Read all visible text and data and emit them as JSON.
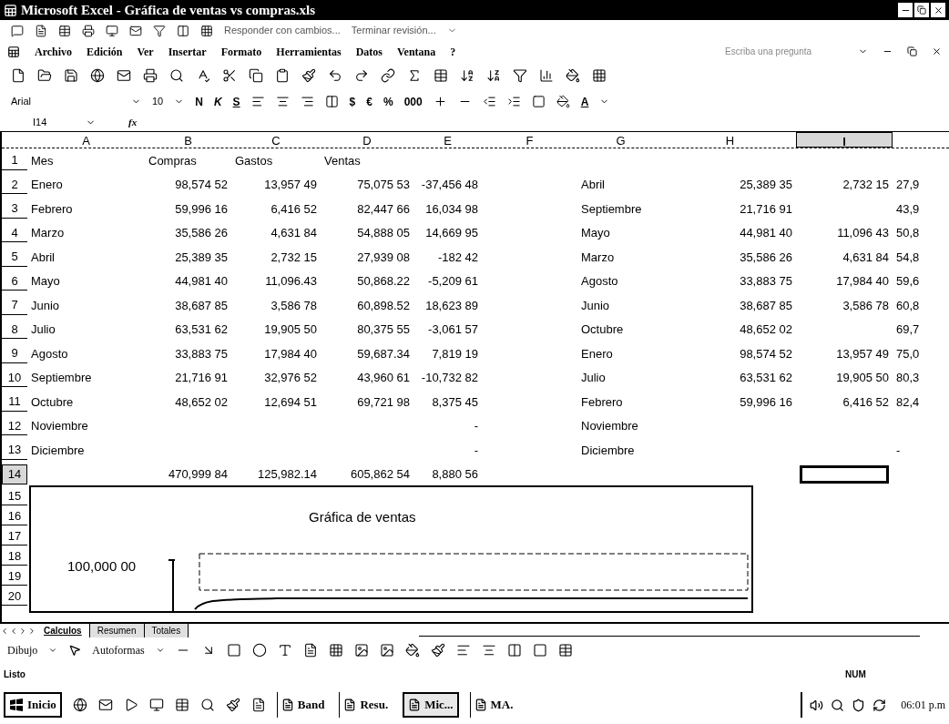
{
  "window": {
    "title": "Microsoft Excel - Gráfica de ventas vs compras.xls"
  },
  "review_toolbar": {
    "reply": "Responder con cambios...",
    "end": "Terminar revisión..."
  },
  "menu": [
    {
      "label": "Archivo"
    },
    {
      "label": "Edición"
    },
    {
      "label": "Ver"
    },
    {
      "label": "Insertar"
    },
    {
      "label": "Formato"
    },
    {
      "label": "Herramientas"
    },
    {
      "label": "Datos"
    },
    {
      "label": "Ventana"
    },
    {
      "label": "?"
    }
  ],
  "help_box": {
    "placeholder": "Escriba una pregunta"
  },
  "format_toolbar": {
    "font": "Arial",
    "size": "10",
    "bold": "N",
    "italic": "K",
    "underline": "S",
    "number_buttons": [
      "$",
      "€",
      "%",
      "000"
    ],
    "font_color": "A"
  },
  "formula_bar": {
    "name_box": "I14",
    "fx": "fx"
  },
  "sheet": {
    "columns": [
      {
        "label": "A",
        "selected": false
      },
      {
        "label": "B",
        "selected": false
      },
      {
        "label": "C",
        "selected": false
      },
      {
        "label": "D",
        "selected": false
      },
      {
        "label": "E",
        "selected": false
      },
      {
        "label": "F",
        "selected": false
      },
      {
        "label": "G",
        "selected": false
      },
      {
        "label": "H",
        "selected": false
      },
      {
        "label": "I",
        "selected": true
      }
    ],
    "rows": [
      {
        "number": "1",
        "kind": "header",
        "selected": false,
        "cells": [
          {
            "text": "Mes"
          },
          {
            "text": "Compras"
          },
          {
            "text": "Gastos"
          },
          {
            "text": "Ventas"
          },
          {},
          {},
          {},
          {},
          {},
          {}
        ]
      },
      {
        "number": "2",
        "kind": "data",
        "selected": false,
        "cells": [
          {
            "text": "Enero"
          },
          {
            "text": "98,574 52"
          },
          {
            "text": "13,957 49"
          },
          {
            "text": "75,075 53"
          },
          {
            "sign": "-",
            "text": "37,456 48"
          },
          {},
          {
            "text": "Abril"
          },
          {
            "text": "25,389 35"
          },
          {
            "text": "2,732 15"
          },
          {
            "text": "27,9"
          }
        ]
      },
      {
        "number": "3",
        "kind": "data",
        "selected": false,
        "cells": [
          {
            "text": "Febrero"
          },
          {
            "text": "59,996 16"
          },
          {
            "text": "6,416 52"
          },
          {
            "text": "82,447 66"
          },
          {
            "text": "16,034 98"
          },
          {},
          {
            "text": "Septiembre"
          },
          {
            "text": "21,716 91"
          },
          {},
          {
            "text": "43,9"
          }
        ]
      },
      {
        "number": "4",
        "kind": "data",
        "selected": false,
        "cells": [
          {
            "text": "Marzo"
          },
          {
            "text": "35,586 26"
          },
          {
            "text": "4,631 84"
          },
          {
            "text": "54,888 05"
          },
          {
            "text": "14,669 95"
          },
          {},
          {
            "text": "Mayo"
          },
          {
            "text": "44,981 40"
          },
          {
            "text": "11,096 43"
          },
          {
            "text": "50,8"
          }
        ]
      },
      {
        "number": "5",
        "kind": "data",
        "selected": false,
        "cells": [
          {
            "text": "Abril"
          },
          {
            "text": "25,389 35"
          },
          {
            "text": "2,732 15"
          },
          {
            "text": "27,939 08"
          },
          {
            "sign": "-",
            "text": "182 42"
          },
          {},
          {
            "text": "Marzo"
          },
          {
            "text": "35,586 26"
          },
          {
            "text": "4,631 84"
          },
          {
            "text": "54,8"
          }
        ]
      },
      {
        "number": "6",
        "kind": "data",
        "selected": false,
        "cells": [
          {
            "text": "Mayo"
          },
          {
            "text": "44,981 40"
          },
          {
            "text": "11,096.43"
          },
          {
            "text": "50,868.22"
          },
          {
            "sign": "-",
            "text": "5,209 61"
          },
          {},
          {
            "text": "Agosto"
          },
          {
            "text": "33,883 75"
          },
          {
            "text": "17,984 40"
          },
          {
            "text": "59,6"
          }
        ]
      },
      {
        "number": "7",
        "kind": "data",
        "selected": false,
        "cells": [
          {
            "text": "Junio"
          },
          {
            "text": "38,687 85"
          },
          {
            "text": "3,586 78"
          },
          {
            "text": "60,898.52"
          },
          {
            "text": "18,623 89"
          },
          {},
          {
            "text": "Junio"
          },
          {
            "text": "38,687 85"
          },
          {
            "text": "3,586 78"
          },
          {
            "text": "60,8"
          }
        ]
      },
      {
        "number": "8",
        "kind": "data",
        "selected": false,
        "cells": [
          {
            "text": "Julio"
          },
          {
            "text": "63,531 62"
          },
          {
            "text": "19,905 50"
          },
          {
            "text": "80,375 55"
          },
          {
            "sign": "-",
            "text": "3,061 57"
          },
          {},
          {
            "text": "Octubre"
          },
          {
            "text": "48,652 02"
          },
          {},
          {
            "text": "69,7"
          }
        ]
      },
      {
        "number": "9",
        "kind": "data",
        "selected": false,
        "cells": [
          {
            "text": "Agosto"
          },
          {
            "text": "33,883 75"
          },
          {
            "text": "17,984 40"
          },
          {
            "text": "59,687.34"
          },
          {
            "text": "7,819 19"
          },
          {},
          {
            "text": "Enero"
          },
          {
            "text": "98,574 52"
          },
          {
            "text": "13,957 49"
          },
          {
            "text": "75,0"
          }
        ]
      },
      {
        "number": "10",
        "kind": "data",
        "selected": false,
        "cells": [
          {
            "text": "Septiembre"
          },
          {
            "text": "21,716 91"
          },
          {
            "text": "32,976 52"
          },
          {
            "text": "43,960 61"
          },
          {
            "sign": "-",
            "text": "10,732 82"
          },
          {},
          {
            "text": "Julio"
          },
          {
            "text": "63,531 62"
          },
          {
            "text": "19,905 50"
          },
          {
            "text": "80,3"
          }
        ]
      },
      {
        "number": "11",
        "kind": "data",
        "selected": false,
        "cells": [
          {
            "text": "Octubre"
          },
          {
            "text": "48,652 02"
          },
          {
            "text": "12,694 51"
          },
          {
            "text": "69,721 98"
          },
          {
            "text": "8,375 45"
          },
          {},
          {
            "text": "Febrero"
          },
          {
            "text": "59,996 16"
          },
          {
            "text": "6,416 52"
          },
          {
            "text": "82,4"
          }
        ]
      },
      {
        "number": "12",
        "kind": "data",
        "selected": false,
        "cells": [
          {
            "text": "Noviembre"
          },
          {},
          {},
          {},
          {
            "text": "-"
          },
          {},
          {
            "text": "Noviembre"
          },
          {},
          {},
          {}
        ]
      },
      {
        "number": "13",
        "kind": "data",
        "selected": false,
        "cells": [
          {
            "text": "Diciembre"
          },
          {},
          {},
          {},
          {
            "text": "-"
          },
          {},
          {
            "text": "Diciembre"
          },
          {},
          {},
          {
            "text": "-"
          }
        ]
      },
      {
        "number": "14",
        "kind": "total",
        "selected": true,
        "cells": [
          {},
          {
            "text": "470,999 84"
          },
          {
            "text": "125,982.14"
          },
          {
            "text": "605,862 54"
          },
          {
            "text": "8,880 56"
          },
          {},
          {},
          {},
          {},
          {}
        ]
      },
      {
        "number": "15",
        "kind": "blank",
        "selected": false,
        "cells": []
      },
      {
        "number": "16",
        "kind": "blank",
        "selected": false,
        "cells": []
      },
      {
        "number": "17",
        "kind": "blank",
        "selected": false,
        "cells": []
      },
      {
        "number": "18",
        "kind": "blank",
        "selected": false,
        "cells": []
      },
      {
        "number": "19",
        "kind": "blank",
        "selected": false,
        "cells": []
      },
      {
        "number": "20",
        "kind": "blank",
        "selected": false,
        "cells": []
      }
    ]
  },
  "chart": {
    "title": "Gráfica de ventas",
    "y_tick": "100,000 00"
  },
  "sheet_tabs": [
    {
      "label": "Calculos",
      "selected": true
    },
    {
      "label": "Resumen",
      "selected": false
    },
    {
      "label": "Totales",
      "selected": false
    }
  ],
  "drawing_toolbar": {
    "draw": "Dibujo",
    "autoshapes": "Autoformas"
  },
  "status_bar": {
    "status": "Listo",
    "num": "NUM"
  },
  "taskbar": {
    "start": "Inicio",
    "tasks": [
      {
        "label": "Band",
        "selected": false
      },
      {
        "label": "Resu.",
        "selected": false
      },
      {
        "label": "Mic...",
        "selected": true
      },
      {
        "label": "MA.",
        "selected": false
      }
    ],
    "clock": "06:01 p.m"
  }
}
